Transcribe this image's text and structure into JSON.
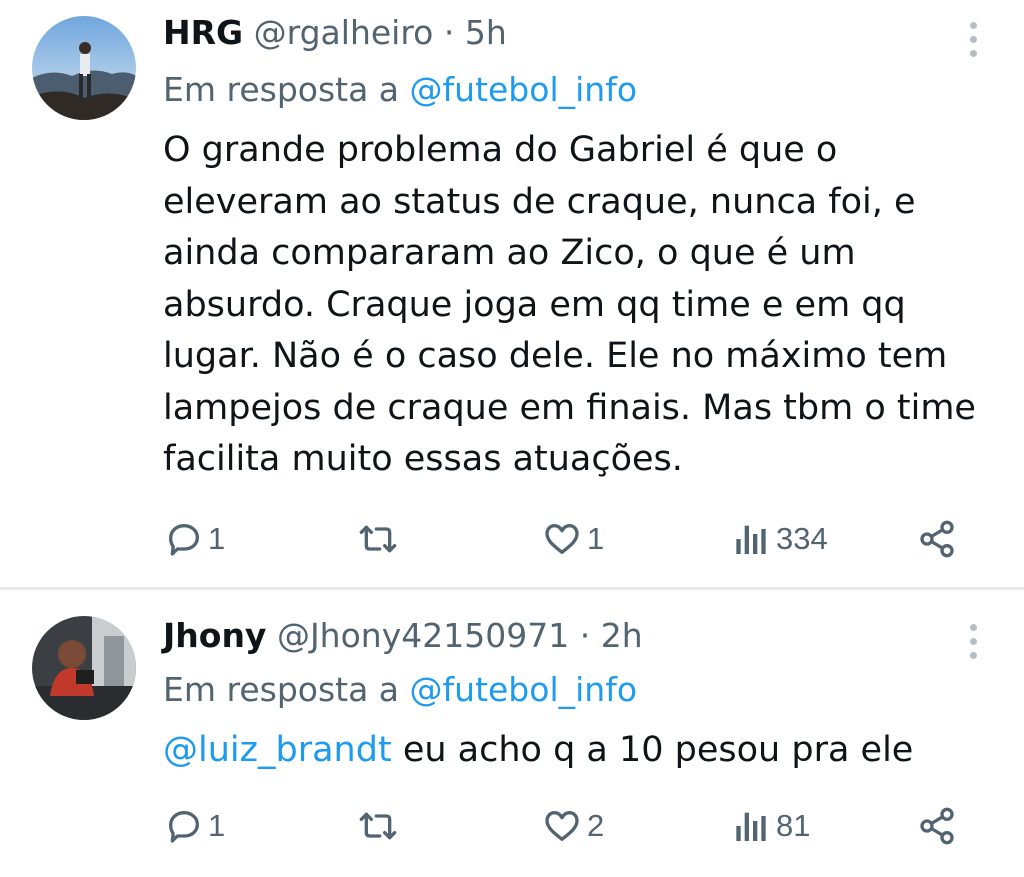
{
  "tweets": [
    {
      "name": "HRG",
      "handle": "@rgalheiro",
      "separator": "·",
      "time": "5h",
      "reply_prefix": "Em resposta a",
      "reply_to": "@futebol_info",
      "body_mention": "",
      "body_text": "O grande problema do Gabriel é que o eleveram ao status de craque, nunca foi, e ainda compararam ao Zico, o que é um absurdo. Craque joga em qq time e em qq lugar. Não é o caso dele. Ele no máximo tem lampejos de craque em finais. Mas tbm o time facilita muito essas atuações.",
      "replies": "1",
      "retweets": "",
      "likes": "1",
      "views": "334"
    },
    {
      "name": "Jhony",
      "handle": "@Jhony42150971",
      "separator": "·",
      "time": "2h",
      "reply_prefix": "Em resposta a",
      "reply_to": "@futebol_info",
      "body_mention": "@luiz_brandt",
      "body_text": " eu acho q a 10 pesou pra ele",
      "replies": "1",
      "retweets": "",
      "likes": "2",
      "views": "81"
    }
  ],
  "colors": {
    "text": "#0f1419",
    "secondary": "#536471",
    "link": "#1d9bf0",
    "divider": "#e6e9ec",
    "icon": "#536471"
  },
  "icons": [
    "avatar",
    "more-icon",
    "reply-icon",
    "retweet-icon",
    "like-icon",
    "views-icon",
    "share-icon"
  ]
}
